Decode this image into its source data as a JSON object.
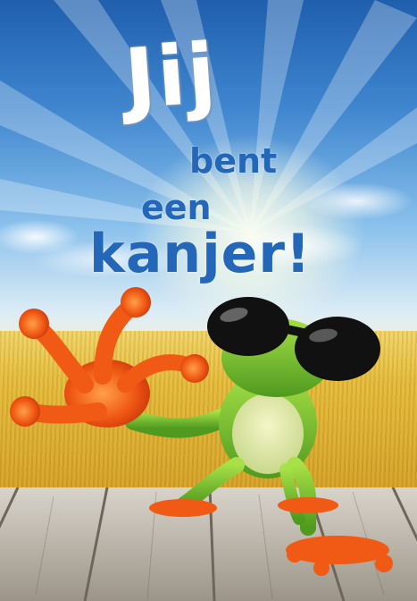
{
  "card": {
    "title": "Jij",
    "line_bent": "bent",
    "line_een": "een",
    "line_kanjer": "kanjer!"
  },
  "colors": {
    "sky_top": "#1f5fae",
    "text_blue": "#2467b8",
    "frog_green": "#7fc82e",
    "frog_orange": "#f05a14",
    "glasses": "#111111",
    "wheat": "#e2b93a",
    "deck_wood": "#b9b2a6"
  },
  "icons": [
    "frog-with-sunglasses",
    "sun-rays",
    "wheat-field",
    "wooden-deck"
  ]
}
